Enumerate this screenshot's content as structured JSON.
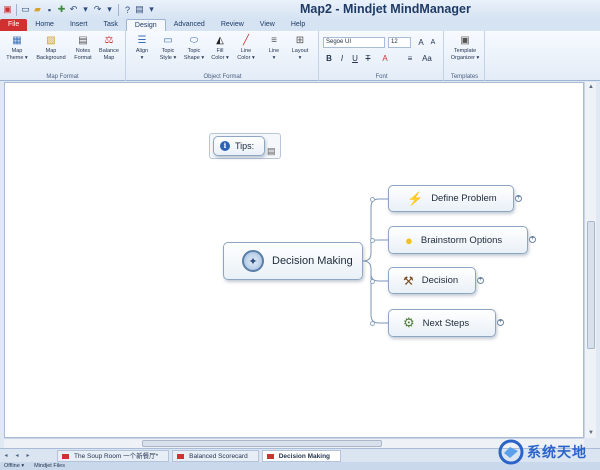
{
  "title": "Map2 - Mindjet MindManager",
  "tabs": [
    "File",
    "Home",
    "Insert",
    "Task",
    "Design",
    "Advanced",
    "Review",
    "View",
    "Help"
  ],
  "active_tab": "Design",
  "ribbon": {
    "map_format": {
      "label": "Map Format",
      "buttons": [
        "Map\nTheme ▾",
        "Map\nBackground",
        "Notes\nFormat",
        "Balance\nMap"
      ]
    },
    "object_format": {
      "label": "Object Format",
      "buttons": [
        "Align\n▾",
        "Topic\nStyle ▾",
        "Topic\nShape ▾",
        "Fill\nColor ▾",
        "Line\nColor ▾",
        "Line\n▾",
        "Layout\n▾"
      ]
    },
    "font": {
      "label": "Font",
      "family": "Segoe UI",
      "size": "12"
    },
    "templates": {
      "label": "Templates",
      "button": "Template\nOrganizer ▾"
    }
  },
  "map": {
    "central": "Decision Making",
    "floating": "Tips:",
    "subtopics": [
      "Define Problem",
      "Brainstorm Options",
      "Decision",
      "Next Steps"
    ]
  },
  "sheets": [
    "The Soup Room 一个新餐厅*",
    "Balanced Scorecard",
    "Decision Making"
  ],
  "active_sheet": "Decision Making",
  "status": [
    "Offline ▾",
    "Mindjet Files"
  ],
  "watermark": "系统天地",
  "colors": {
    "file_tab": "#d0302f",
    "accent": "#1e3b66",
    "node_border": "#8ea6c2"
  }
}
